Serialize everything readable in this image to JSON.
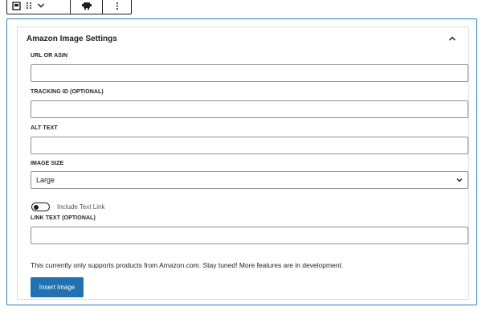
{
  "toolbar": {
    "icons": [
      "block-type-icon",
      "drag-handle-icon",
      "chevron-down-icon",
      "amazon-block-icon",
      "more-options-icon"
    ],
    "stray_text": "́"
  },
  "panel": {
    "title": "Amazon Image Settings",
    "collapse_icon": "chevron-up-icon",
    "fields": {
      "url_label": "URL OR ASIN",
      "url_value": "",
      "tracking_label": "TRACKING ID (OPTIONAL)",
      "tracking_value": "",
      "alt_label": "ALT TEXT",
      "alt_value": "",
      "size_label": "IMAGE SIZE",
      "size_selected": "Large",
      "toggle_label": "Include Text Link",
      "toggle_on": false,
      "link_label": "LINK TEXT (OPTIONAL)",
      "link_value": ""
    },
    "note": "This currently only supports products from Amazon.com. Stay tuned! More features are in development.",
    "insert_button": "Insert Image"
  },
  "colors": {
    "accent": "#2271b1",
    "block_border": "#2f7ac4",
    "input_border": "#8c8f94"
  }
}
